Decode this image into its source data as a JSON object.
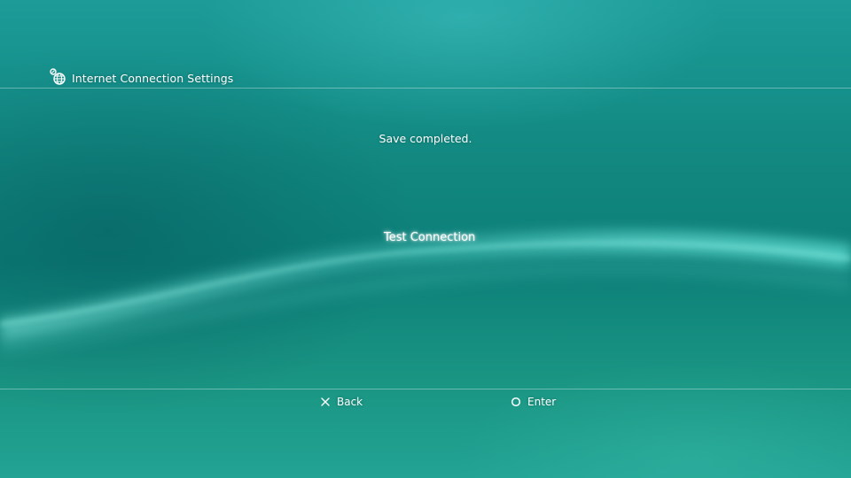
{
  "header": {
    "icon": "network-settings-icon",
    "title": "Internet Connection Settings"
  },
  "main": {
    "message": "Save completed.",
    "options": [
      {
        "label": "Test Connection",
        "selected": true
      }
    ]
  },
  "footer": {
    "back": {
      "icon": "cross-button-icon",
      "label": "Back"
    },
    "enter": {
      "icon": "circle-button-icon",
      "label": "Enter"
    }
  },
  "colors": {
    "background": "#11877f",
    "wave": "#4fdad0",
    "text": "#ffffff"
  }
}
